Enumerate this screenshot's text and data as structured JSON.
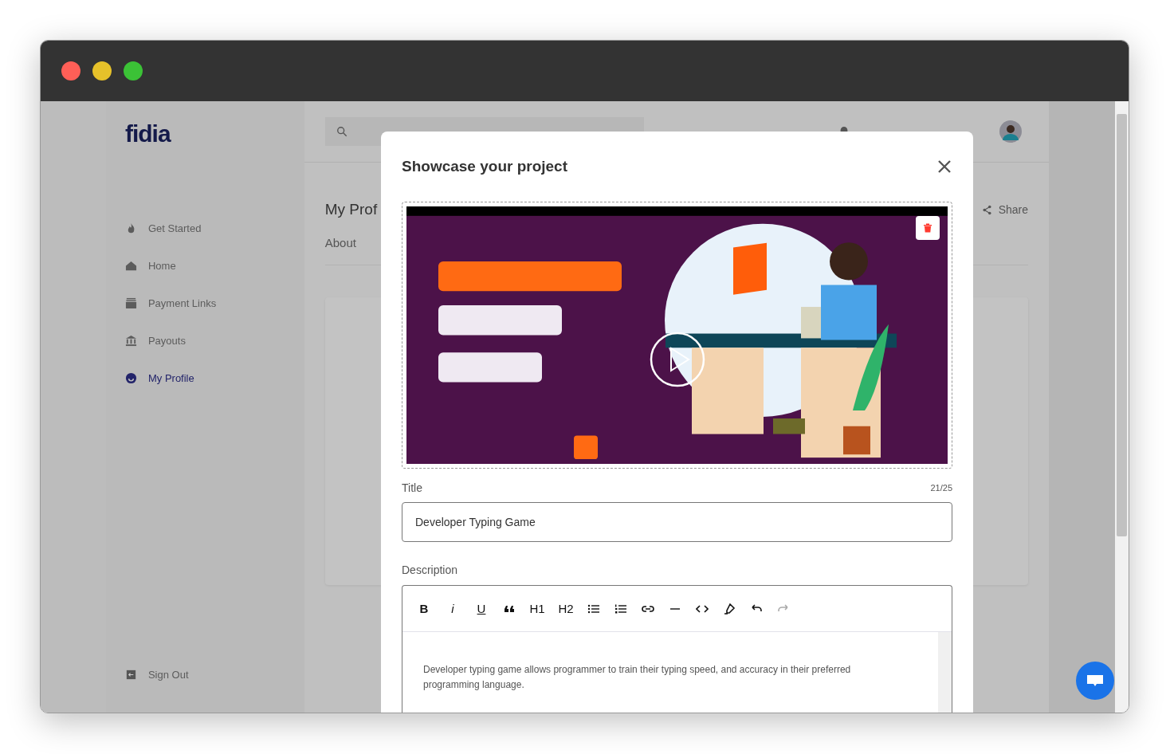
{
  "sidebar": {
    "logo": "fidia",
    "items": [
      {
        "kind": "flame",
        "label": "Get Started",
        "selected": false
      },
      {
        "kind": "home",
        "label": "Home",
        "selected": false
      },
      {
        "kind": "wallet",
        "label": "Payment Links",
        "selected": false
      },
      {
        "kind": "bank",
        "label": "Payouts",
        "selected": false
      },
      {
        "kind": "profile",
        "label": "My Profile",
        "selected": true
      }
    ],
    "sign_out": "Sign Out"
  },
  "page": {
    "title": "My Prof",
    "share": "Share",
    "tabs": [
      {
        "label": "About"
      }
    ]
  },
  "modal": {
    "title": "Showcase your project",
    "title_field": {
      "label": "Title",
      "counter": "21/25",
      "value": "Developer Typing Game"
    },
    "description": {
      "label": "Description",
      "toolbar": [
        {
          "kind": "text",
          "label": "B",
          "disabled": false
        },
        {
          "kind": "text",
          "label": "i",
          "disabled": false
        },
        {
          "kind": "text",
          "label": "U",
          "disabled": false
        },
        {
          "kind": "quote",
          "disabled": false
        },
        {
          "kind": "text",
          "label": "H1",
          "disabled": false
        },
        {
          "kind": "text",
          "label": "H2",
          "disabled": false
        },
        {
          "kind": "bullets",
          "disabled": false
        },
        {
          "kind": "numbers",
          "disabled": false
        },
        {
          "kind": "link",
          "disabled": false
        },
        {
          "kind": "rule",
          "disabled": false
        },
        {
          "kind": "code",
          "disabled": false
        },
        {
          "kind": "highlight",
          "disabled": false
        },
        {
          "kind": "undo",
          "disabled": false
        },
        {
          "kind": "redo",
          "disabled": true
        }
      ],
      "text": "Developer typing game allows programmer to train their typing speed, and accuracy in their preferred programming language."
    }
  }
}
